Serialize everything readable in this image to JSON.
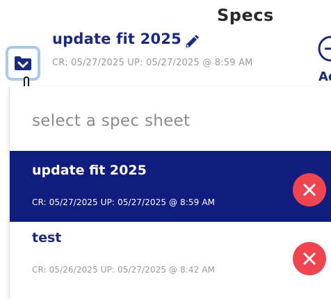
{
  "header": {
    "section_title": "Specs",
    "current_spec": {
      "name": "update fit 2025",
      "meta": "CR: 05/27/2025 UP: 05/27/2025 @ 8:59 AM"
    },
    "add_label": "Ad"
  },
  "icons": {
    "folder": "folder-chevron-down-icon",
    "pointer": "hand-pointer-icon",
    "pencil": "pencil-icon",
    "add": "plus-circle-icon",
    "delete": "close-x-icon"
  },
  "dropdown": {
    "header": "select a spec sheet",
    "items": [
      {
        "name": "update fit 2025",
        "meta": "CR: 05/27/2025 UP: 05/27/2025 @ 8:59 AM",
        "selected": true
      },
      {
        "name": "test",
        "meta": "CR: 05/26/2025 UP: 05/27/2025 @ 8:42 AM",
        "selected": false
      }
    ]
  },
  "colors": {
    "brand_navy": "#1b2a7f",
    "selected_bg": "#101c7e",
    "delete_red": "#ef4550",
    "focus_ring": "#a9c9ef",
    "muted_text": "#9a9a9a"
  }
}
